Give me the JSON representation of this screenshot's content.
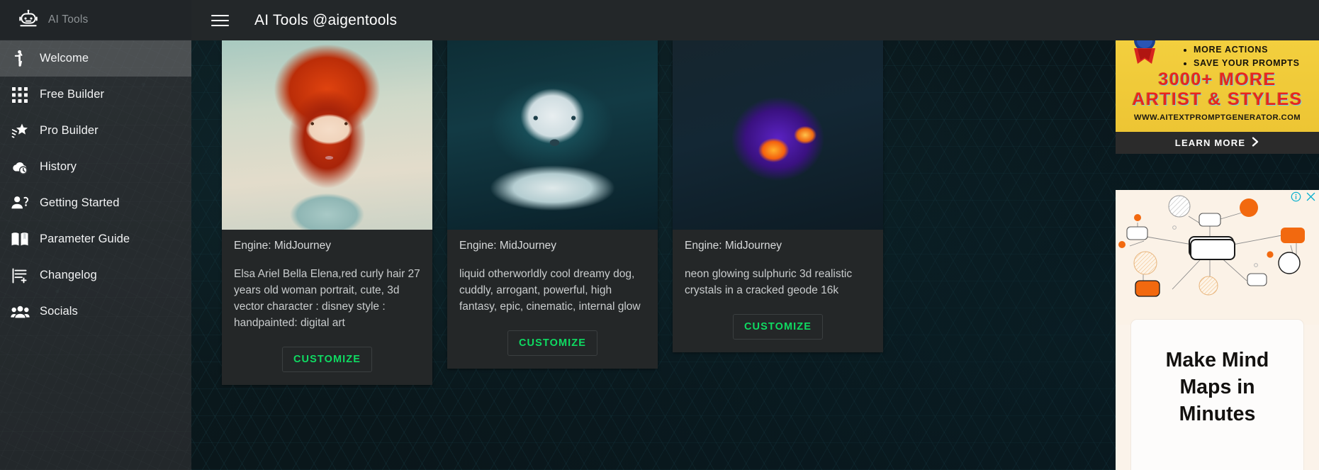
{
  "sidebar": {
    "brand": {
      "icon": "robot-icon",
      "label": "AI Tools"
    },
    "items": [
      {
        "icon": "person-waving-icon",
        "label": "Welcome",
        "active": true
      },
      {
        "icon": "grid-apps-icon",
        "label": "Free Builder",
        "active": false
      },
      {
        "icon": "shooting-star-icon",
        "label": "Pro Builder",
        "active": false
      },
      {
        "icon": "cloud-clock-icon",
        "label": "History",
        "active": false
      },
      {
        "icon": "person-question-icon",
        "label": "Getting Started",
        "active": false
      },
      {
        "icon": "open-book-icon",
        "label": "Parameter Guide",
        "active": false
      },
      {
        "icon": "changelog-icon",
        "label": "Changelog",
        "active": false
      },
      {
        "icon": "people-group-icon",
        "label": "Socials",
        "active": false
      }
    ]
  },
  "topbar": {
    "menu_icon": "hamburger-icon",
    "title": "AI Tools @aigentools"
  },
  "cards": [
    {
      "engine": "Engine: MidJourney",
      "prompt": "Elsa Ariel Bella Elena,red curly hair 27 years old woman portrait, cute, 3d vector character : disney style : handpainted: digital art",
      "button": "CUSTOMIZE",
      "image_alt": "red-curly-haired-woman-portrait"
    },
    {
      "engine": "Engine: MidJourney",
      "prompt": "liquid otherworldly cool dreamy dog, cuddly, arrogant, powerful, high fantasy, epic, cinematic, internal glow",
      "button": "CUSTOMIZE",
      "image_alt": "white-glowing-dog-liquid"
    },
    {
      "engine": "Engine: MidJourney",
      "prompt": "neon glowing sulphuric 3d realistic crystals in a cracked geode 16k",
      "button": "CUSTOMIZE",
      "image_alt": "purple-neon-crystal-geode"
    }
  ],
  "ad_top": {
    "bullets": [
      "MORE ACTIONS",
      "SAVE YOUR PROMPTS"
    ],
    "headline_line1": "3000+ MORE",
    "headline_line2": "ARTIST & STYLES",
    "url": "WWW.AITEXTPROMPTGENERATOR.COM",
    "cta": "LEARN MORE",
    "cta_icon": "chevron-right-icon",
    "colors": {
      "bg": "#f0c93a",
      "text": "#e8251f",
      "cta_bg": "#2b2b2b"
    }
  },
  "ad_bottom": {
    "info_icon": "ad-info-icon",
    "close_icon": "ad-close-icon",
    "headline": "Make Mind Maps in Minutes",
    "colors": {
      "bg": "#fbf3ea",
      "accent": "#f26a16"
    }
  },
  "theme": {
    "sidebar_bg": "#262b2e",
    "topbar_bg": "#232729",
    "card_bg": "#242728",
    "accent_green": "#0fdb62",
    "main_bg": "#0a171b"
  }
}
